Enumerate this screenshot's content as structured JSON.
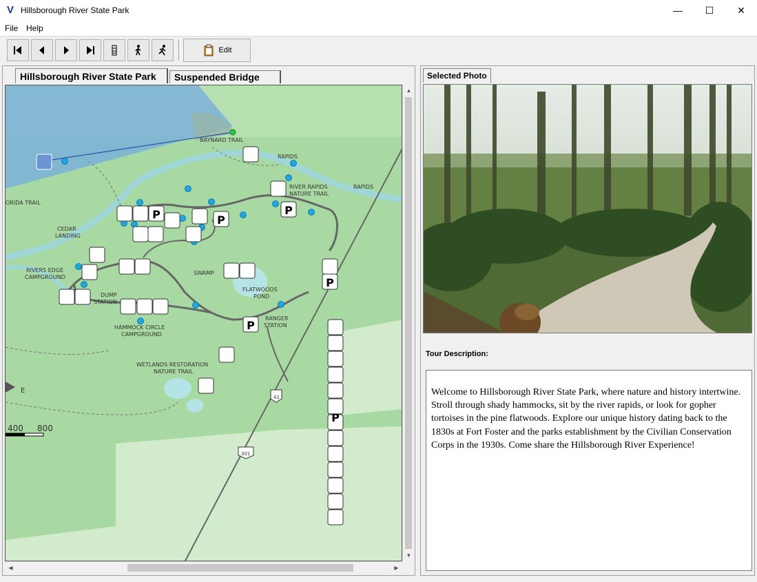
{
  "window": {
    "title": "Hillsborough River State Park",
    "icon": "v-app-icon",
    "controls": [
      "minimize-icon",
      "maximize-icon",
      "close-icon"
    ]
  },
  "menu": [
    "File",
    "Help"
  ],
  "toolbar": {
    "buttons": [
      "first-icon",
      "previous-icon",
      "next-icon",
      "last-icon",
      "route-icon",
      "walk-icon",
      "run-icon"
    ],
    "edit_label": "Edit"
  },
  "left_tabs": [
    "Hillsborough River State Park",
    "Suspended Bridge"
  ],
  "map": {
    "labels": {
      "baynard": "BAYNARD TRAIL",
      "rapids1": "RAPIDS",
      "rapids2": "RAPIDS",
      "river_rapids": "RIVER RAPIDS",
      "nature_trail": "NATURE TRAIL",
      "florida_trail": "ORIDA TRAIL",
      "cedar": "CEDAR",
      "landing": "LANDING",
      "rivers_edge": "RIVERS EDGE",
      "campground1": "CAMPGROUND",
      "swamp": "SWAMP",
      "flatwoods": "FLATWOODS",
      "pond": "POND",
      "dump": "DUMP",
      "station1": "STATION",
      "hammock": "HAMMOCK CIRCLE",
      "campground2": "CAMPGROUND",
      "ranger": "RANGER",
      "station2": "STATION",
      "wetlands": "WETLANDS RESTORATION",
      "nature_trail2": "NATURE TRAIL",
      "compass_e": "E",
      "scale_400": "400",
      "scale_800": "800",
      "road_41": "41",
      "road_301": "301"
    }
  },
  "right_tab": "Selected Photo",
  "tour_label": "Tour Description:",
  "tour_text": "Welcome to Hillsborough River State Park, where nature and history intertwine. Stroll through shady hammocks, sit by the river rapids, or look for gopher tortoises in the pine flatwoods. Explore our unique history dating back to the 1830s at Fort Foster and the parks establishment by the Civilian Conservation Corps in the 1930s. Come share the Hillsborough River Experience!",
  "colors": {
    "map_land": "#a8d8a0",
    "map_light": "#cfe8c8",
    "water": "#9fd6d8",
    "view_cone": "#5a9ad8",
    "waypoint": "#1aa8e8",
    "trail": "#555555"
  }
}
